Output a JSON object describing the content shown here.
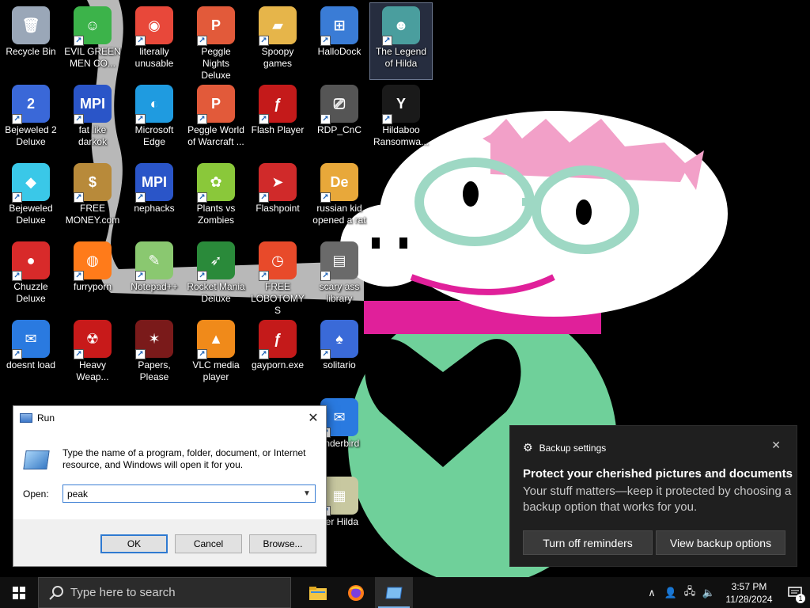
{
  "desktop": {
    "icons": [
      {
        "label": "Recycle Bin",
        "icon": "recycle-bin-icon"
      },
      {
        "label": "EVIL GREEN MEN CO...",
        "icon": "green-men-icon"
      },
      {
        "label": "literally unusable",
        "icon": "chrome-icon"
      },
      {
        "label": "Peggle Nights Deluxe",
        "icon": "peggle-icon"
      },
      {
        "label": "Spoopy games",
        "icon": "folder-icon"
      },
      {
        "label": "HalloDock",
        "icon": "windows-shield-icon"
      },
      {
        "label": "The Legend of Hilda",
        "icon": "game-character-icon"
      },
      {
        "label": "Bejeweled 2 Deluxe",
        "icon": "bejeweled2-icon"
      },
      {
        "label": "fat like darkok",
        "icon": "mpi-icon"
      },
      {
        "label": "Microsoft Edge",
        "icon": "edge-icon"
      },
      {
        "label": "Peggle World of Warcraft ...",
        "icon": "peggle-icon"
      },
      {
        "label": "Flash Player",
        "icon": "flash-icon"
      },
      {
        "label": "RDP_CnC",
        "icon": "rdp-icon"
      },
      {
        "label": "Hildaboo Ransomwa...",
        "icon": "yashma-icon"
      },
      {
        "label": "Bejeweled Deluxe",
        "icon": "gem-icon"
      },
      {
        "label": "FREE MONEY.com",
        "icon": "money-bag-icon"
      },
      {
        "label": "nephacks",
        "icon": "mpi-icon"
      },
      {
        "label": "Plants vs Zombies",
        "icon": "flower-icon"
      },
      {
        "label": "Flashpoint",
        "icon": "flashpoint-icon"
      },
      {
        "label": "russian kid opened a rat",
        "icon": "de-icon"
      },
      {
        "label": "Chuzzle Deluxe",
        "icon": "chuzzle-icon"
      },
      {
        "label": "furryporn",
        "icon": "firefox-icon"
      },
      {
        "label": "Notepad++",
        "icon": "notepad-icon"
      },
      {
        "label": "Rocket Mania Deluxe",
        "icon": "rocket-icon"
      },
      {
        "label": "FREE LOBOTOMYS",
        "icon": "clock-icon"
      },
      {
        "label": "scary ass library",
        "icon": "library-icon"
      },
      {
        "label": "doesnt load",
        "icon": "thunderbird-icon"
      },
      {
        "label": "Heavy Weap...",
        "icon": "radiation-icon"
      },
      {
        "label": "Papers, Please",
        "icon": "papers-icon"
      },
      {
        "label": "VLC media player",
        "icon": "vlc-icon"
      },
      {
        "label": "gayporn.exe",
        "icon": "flash-icon"
      },
      {
        "label": "solitario",
        "icon": "cards-icon"
      },
      {
        "label": "underbird",
        "icon": "thunderbird-icon"
      },
      {
        "label": "per Hilda",
        "icon": "pixel-icon"
      }
    ]
  },
  "run_dialog": {
    "title": "Run",
    "description": "Type the name of a program, folder, document, or Internet resource, and Windows will open it for you.",
    "open_label": "Open:",
    "input_value": "peak",
    "ok_label": "OK",
    "cancel_label": "Cancel",
    "browse_label": "Browse..."
  },
  "notification": {
    "app_name": "Backup settings",
    "title": "Protect your cherished pictures and documents",
    "body": "Your stuff matters—keep it protected by choosing a backup option that works for you.",
    "button_turn_off": "Turn off reminders",
    "button_view": "View backup options"
  },
  "taskbar": {
    "search_placeholder": "Type here to search",
    "time": "3:57 PM",
    "date": "11/28/2024",
    "notification_count": "1"
  },
  "colors": {
    "accent": "#2f7ad1",
    "toast_bg": "#1f1f1f",
    "taskbar_bg": "#101010",
    "wallpaper_bg": "#000000",
    "character_green": "#6fd09a",
    "character_pink": "#e0209a"
  }
}
